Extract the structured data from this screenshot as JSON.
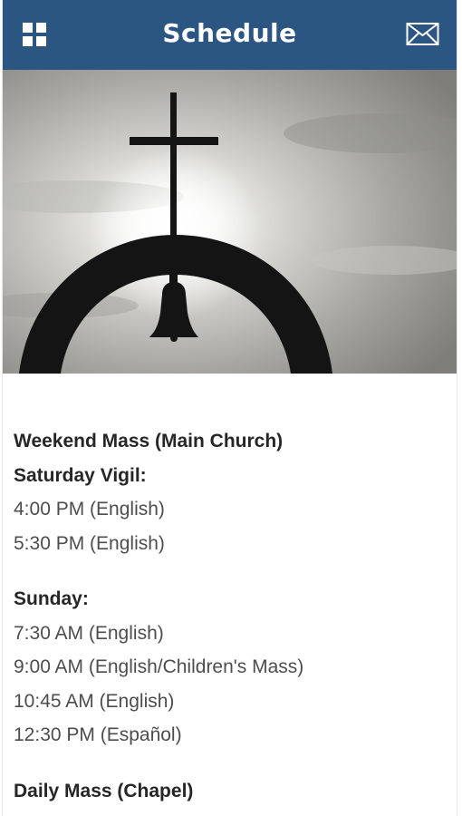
{
  "header": {
    "title": "Schedule",
    "menu_icon": "grid-menu-icon",
    "mail_icon": "envelope-icon",
    "background": "#2c5682"
  },
  "hero": {
    "image": "cross-bell-silhouette"
  },
  "schedule": {
    "weekend_heading": "Weekend Mass (Main Church)",
    "saturday_heading": "Saturday Vigil:",
    "saturday_times": [
      "4:00 PM (English)",
      "5:30 PM (English)"
    ],
    "sunday_heading": "Sunday:",
    "sunday_times": [
      "7:30 AM (English)",
      "9:00 AM (English/Children's Mass)",
      "10:45 AM (English)",
      "12:30 PM (Español)"
    ],
    "daily_heading": "Daily Mass (Chapel)"
  }
}
